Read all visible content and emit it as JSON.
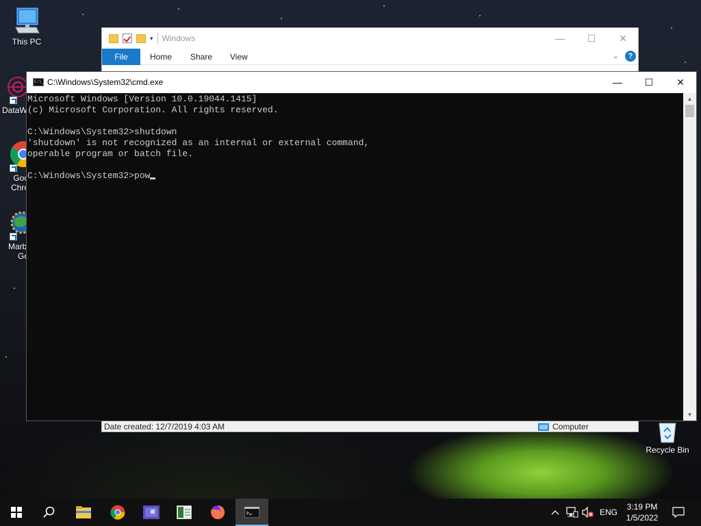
{
  "desktop": {
    "icons": [
      {
        "label": "This PC",
        "icon": "this-pc-icon"
      },
      {
        "label": "DataW",
        "icon": "datawrapper-icon"
      },
      {
        "label": "Goo\nChro",
        "icon": "chrome-icon"
      },
      {
        "label": "Marbl\nGo",
        "icon": "marble-icon"
      },
      {
        "label": "Recycle Bin",
        "icon": "recycle-bin-icon"
      }
    ]
  },
  "explorer": {
    "title": "Windows",
    "ribbon_tabs": {
      "file": "File",
      "home": "Home",
      "share": "Share",
      "view": "View"
    },
    "help": "?",
    "status_left": "Date created: 12/7/2019 4:03 AM",
    "status_right": "Computer"
  },
  "cmd": {
    "title": "C:\\Windows\\System32\\cmd.exe",
    "lines": [
      "Microsoft Windows [Version 10.0.19044.1415]",
      "(c) Microsoft Corporation. All rights reserved.",
      "",
      "C:\\Windows\\System32>shutdown",
      "'shutdown' is not recognized as an internal or external command,",
      "operable program or batch file.",
      "",
      "C:\\Windows\\System32>pow"
    ]
  },
  "window_controls": {
    "minimize": "—",
    "maximize": "☐",
    "close": "✕"
  },
  "taskbar": {
    "apps": [
      "start-icon",
      "search-icon",
      "file-explorer-icon",
      "chrome-icon",
      "app-icon",
      "spreadsheet-icon",
      "firefox-icon",
      "cmd-icon"
    ],
    "tray": {
      "language": "ENG",
      "time": "3:19 PM",
      "date": "1/5/2022"
    }
  },
  "colors": {
    "accent": "#1979ca",
    "console_bg": "#0c0c0c",
    "console_text": "#cccccc",
    "taskbar": "#101010"
  }
}
